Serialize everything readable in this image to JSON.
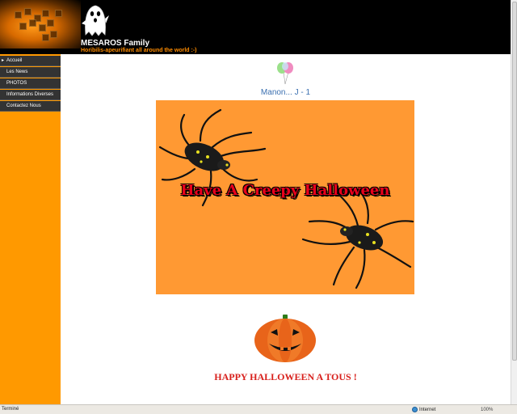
{
  "header": {
    "title": "MESAROS Family",
    "tagline": "Horibilis-apeurifiant all around the world :-)"
  },
  "sidebar": {
    "items": [
      {
        "label": "Accueil",
        "active": true
      },
      {
        "label": "Les News",
        "active": false
      },
      {
        "label": "PHOTOS",
        "active": false
      },
      {
        "label": "Informations Diverses",
        "active": false
      },
      {
        "label": "Contactez Nous",
        "active": false
      }
    ]
  },
  "main": {
    "countdown": "Manon... J - 1",
    "banner_text": "Have A Creepy Halloween",
    "greeting": "HAPPY HALLOWEEN A TOUS !"
  },
  "statusbar": {
    "status": "Terminé",
    "zone": "Internet",
    "zoom": "100%"
  },
  "colors": {
    "header_bg": "#000000",
    "sidebar_bg": "#ff9900",
    "banner_bg": "#ff9933",
    "greeting": "#d8201c",
    "countdown": "#3a6fb0"
  }
}
